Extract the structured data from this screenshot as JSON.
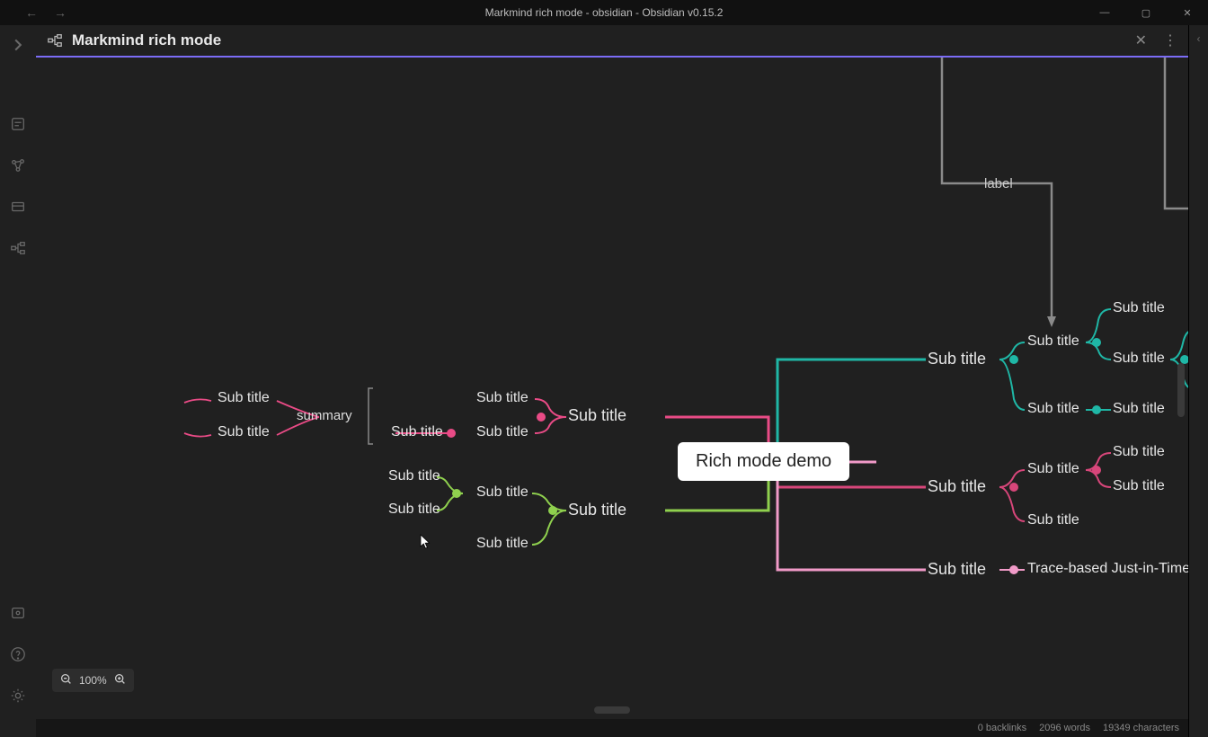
{
  "window": {
    "title": "Markmind rich mode - obsidian - Obsidian v0.15.2"
  },
  "tab": {
    "title": "Markmind rich mode"
  },
  "mindmap": {
    "root": "Rich mode demo",
    "summary_label": "summary",
    "arrow_label": "label",
    "nodes": {
      "crimson_main": "Sub title",
      "crimson_mid": "Sub title",
      "crimson_mid_a": "Sub title",
      "crimson_mid_b": "Sub title",
      "crimson_leaf_a": "Sub title",
      "crimson_leaf_b": "Sub title",
      "green_main": "Sub title",
      "green_mid_a": "Sub title",
      "green_mid_b": "Sub title",
      "green_leaf_a": "Sub title",
      "green_leaf_b": "Sub title",
      "teal_main": "Sub title",
      "teal_mid": "Sub title",
      "teal_mid2": "Sub title",
      "teal_leaf_a": "Sub title",
      "teal_leaf_b": "Sub title",
      "teal_leaf_c": "Sub title",
      "rose_main": "Sub title",
      "rose_mid": "Sub title",
      "rose_mid2": "Sub title",
      "rose_leaf_a": "Sub title",
      "rose_leaf_b": "Sub title",
      "pink_main": "Sub title",
      "pink_leaf": "Trace-based Just-in-Time"
    }
  },
  "zoom": {
    "level": "100%"
  },
  "status": {
    "backlinks": "0 backlinks",
    "words": "2096 words",
    "chars": "19349 characters"
  },
  "colors": {
    "crimson": "#e94b86",
    "green": "#8fd04e",
    "teal": "#1fb7a6",
    "rose": "#d7467a",
    "pink": "#f19ac8"
  }
}
